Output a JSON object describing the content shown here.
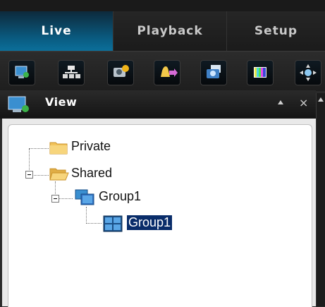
{
  "tabs": [
    {
      "label": "Live",
      "active": true
    },
    {
      "label": "Playback",
      "active": false
    },
    {
      "label": "Setup",
      "active": false
    }
  ],
  "toolbar": {
    "icons": [
      "camera-view-icon",
      "network-icon",
      "camera-settings-icon",
      "alarm-bell-icon",
      "snapshot-icon",
      "color-bars-icon",
      "ptz-control-icon"
    ]
  },
  "view_panel": {
    "title": "View",
    "tree": [
      {
        "label": "Private",
        "type": "folder",
        "level": 0,
        "expanded": false
      },
      {
        "label": "Shared",
        "type": "folder-open",
        "level": 0,
        "expanded": true
      },
      {
        "label": "Group1",
        "type": "group",
        "level": 1,
        "expanded": true
      },
      {
        "label": "Group1",
        "type": "layout",
        "level": 2,
        "selected": true
      }
    ]
  },
  "colors": {
    "active_tab": "#0a5c82",
    "selection": "#0a2d6a",
    "folder": "#f2c35b"
  }
}
